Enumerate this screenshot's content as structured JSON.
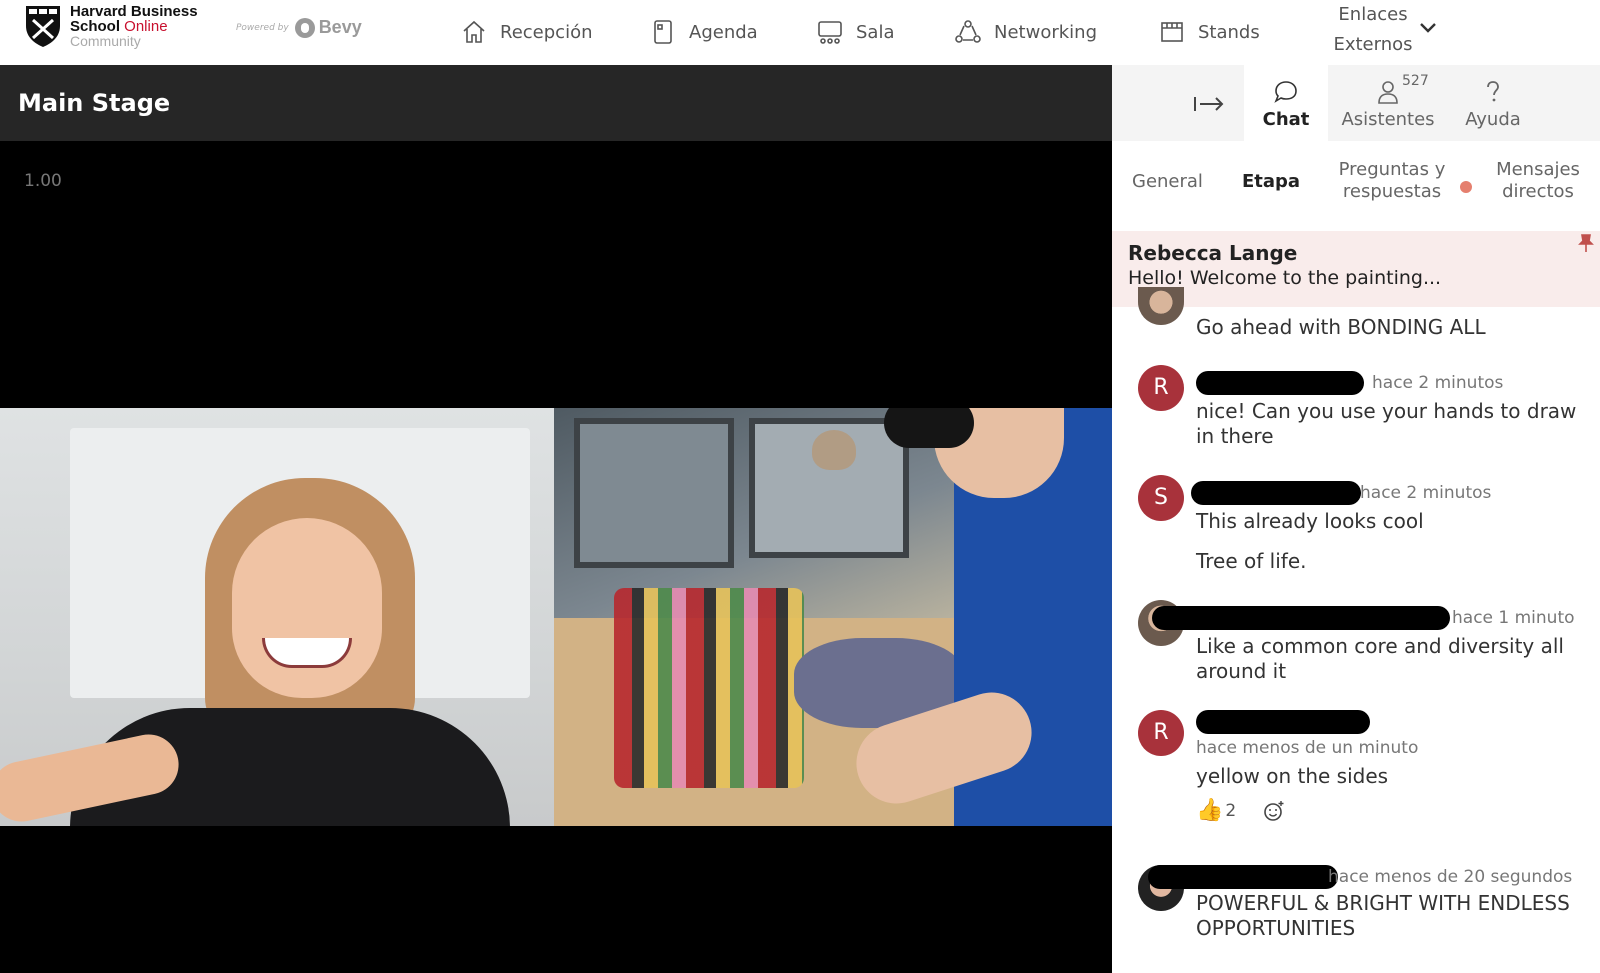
{
  "brand": {
    "line1": "Harvard Business",
    "line2a": "School ",
    "line2b": "Online",
    "line3": "Community",
    "powered_by": "Powered by",
    "bevy": "Bevy"
  },
  "nav": {
    "items": [
      {
        "label": "Recepción",
        "icon": "home-icon"
      },
      {
        "label": "Agenda",
        "icon": "agenda-icon"
      },
      {
        "label": "Sala",
        "icon": "sala-icon"
      },
      {
        "label": "Networking",
        "icon": "networking-icon"
      },
      {
        "label": "Stands",
        "icon": "stands-icon"
      }
    ],
    "dropdown_line1": "Enlaces",
    "dropdown_line2": "Externos"
  },
  "stage": {
    "title": "Main Stage",
    "speed": "1.00"
  },
  "panel": {
    "tabs": [
      {
        "label": "Chat"
      },
      {
        "label": "Asistentes",
        "badge": "527"
      },
      {
        "label": "Ayuda"
      }
    ],
    "subtabs": {
      "general": "General",
      "etapa": "Etapa",
      "qa_line1": "Preguntas y",
      "qa_line2": "respuestas",
      "dm_line1": "Mensajes",
      "dm_line2": "directos"
    },
    "pinned": {
      "name": "Rebecca Lange",
      "message": "Hello! Welcome to the painting..."
    },
    "messages": [
      {
        "text": "Go ahead with BONDING ALL"
      },
      {
        "avatar": "R",
        "time": "hace 2 minutos",
        "text": "nice! Can you use your hands to draw in there"
      },
      {
        "avatar": "S",
        "time": "hace 2 minutos",
        "text": "This already looks cool",
        "text2": "Tree of life."
      },
      {
        "time": "hace 1 minuto",
        "text": "Like a common core and diversity all around it"
      },
      {
        "avatar": "R",
        "time": "hace menos de un minuto",
        "text": "yellow on the sides",
        "reaction_count": "2"
      },
      {
        "time": "hace menos de 20 segundos",
        "text": "POWERFUL & BRIGHT WITH ENDLESS OPPORTUNITIES"
      }
    ]
  }
}
